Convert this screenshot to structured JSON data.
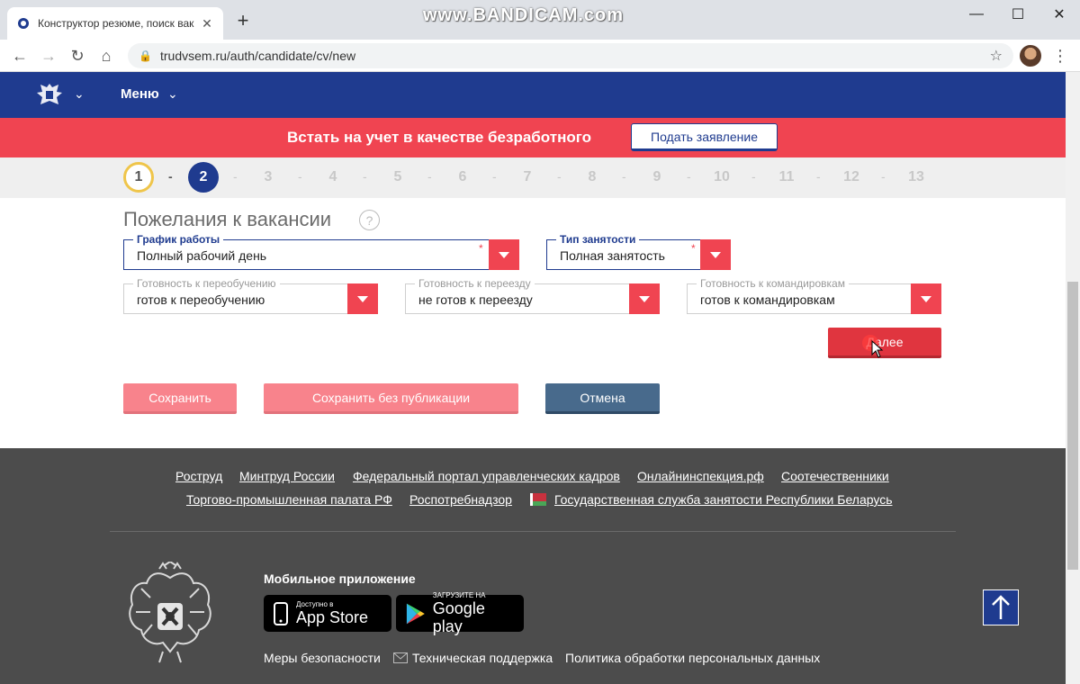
{
  "browser": {
    "tab_title": "Конструктор резюме, поиск вак",
    "url": "trudvsem.ru/auth/candidate/cv/new",
    "watermark": "www.BANDICAM.com"
  },
  "header": {
    "menu_label": "Меню"
  },
  "banner": {
    "text": "Встать на учет в качестве безработного",
    "button": "Подать заявление"
  },
  "stepper": {
    "steps": [
      "1",
      "2",
      "3",
      "4",
      "5",
      "6",
      "7",
      "8",
      "9",
      "10",
      "11",
      "12",
      "13"
    ],
    "current": 2
  },
  "form": {
    "title": "Пожелания к вакансии",
    "help": "?",
    "schedule": {
      "label": "График работы",
      "value": "Полный рабочий день"
    },
    "employment": {
      "label": "Тип занятости",
      "value": "Полная занятость"
    },
    "retraining": {
      "label": "Готовность к переобучению",
      "value": "готов к переобучению"
    },
    "relocation": {
      "label": "Готовность к переезду",
      "value": "не готов к переезду"
    },
    "trips": {
      "label": "Готовность к командировкам",
      "value": "готов к командировкам"
    },
    "required_mark": "*",
    "next": "Далее",
    "save": "Сохранить",
    "save_nopub": "Сохранить без публикации",
    "cancel": "Отмена"
  },
  "footer": {
    "links_row1": [
      "Роструд",
      "Минтруд России",
      "Федеральный портал управленческих кадров",
      "Онлайнинспекция.рф",
      "Соотечественники"
    ],
    "links_row2": [
      "Торгово-промышленная палата РФ",
      "Роспотребнадзор",
      "Государственная служба занятости Республики Беларусь"
    ],
    "mobile_title": "Мобильное приложение",
    "appstore_small": "Доступно в",
    "appstore_big": "App Store",
    "gplay_small": "ЗАГРУЗИТЕ НА",
    "gplay_big": "Google play",
    "security": "Меры безопасности",
    "support": "Техническая поддержка",
    "privacy": "Политика обработки персональных данных"
  },
  "colors": {
    "brand_blue": "#1f3b8f",
    "accent_red": "#f04451",
    "footer_bg": "#4c4c4c"
  }
}
